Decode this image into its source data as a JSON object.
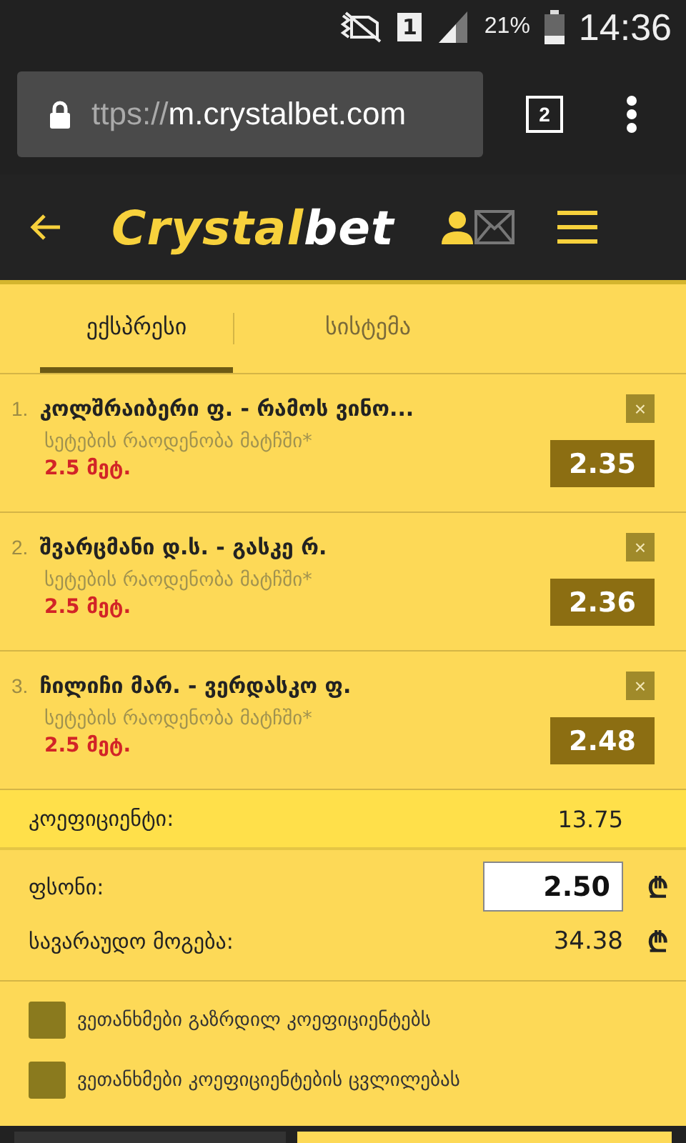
{
  "status_bar": {
    "battery_text": "21%",
    "time": "14:36",
    "sim": "1"
  },
  "browser": {
    "url_scheme": "ttps://",
    "url_host": "m.crystalbet.com",
    "tab_count": "2"
  },
  "header": {
    "logo_first": "Crystal",
    "logo_second": "bet"
  },
  "tabs": [
    {
      "label": "ექსპრესი",
      "selected": true
    },
    {
      "label": "სისტემა",
      "selected": false
    }
  ],
  "bets": [
    {
      "number": "1.",
      "match": "კოლშრაიბერი ფ. - რამოს ვინო...",
      "market": "სეტების რაოდენობა მატჩში*",
      "pick": "2.5 მეტ.",
      "odds": "2.35",
      "remove": "×"
    },
    {
      "number": "2.",
      "match": "შვარცმანი დ.ს. - გასკე რ.",
      "market": "სეტების რაოდენობა მატჩში*",
      "pick": "2.5 მეტ.",
      "odds": "2.36",
      "remove": "×"
    },
    {
      "number": "3.",
      "match": "ჩილიჩი მარ. - ვერდასკო ფ.",
      "market": "სეტების რაოდენობა მატჩში*",
      "pick": "2.5 მეტ.",
      "odds": "2.48",
      "remove": "×"
    }
  ],
  "total": {
    "label": "კოეფიციენტი:",
    "value": "13.75"
  },
  "stake": {
    "label": "ფსონი:",
    "value": "2.50",
    "currency": "₾"
  },
  "winnings": {
    "label": "სავარაუდო მოგება:",
    "value": "34.38",
    "currency": "₾"
  },
  "options": [
    {
      "label": "ვეთანხმები გაზრდილ კოეფიციენტებს",
      "checked": false
    },
    {
      "label": "ვეთანხმები კოეფიციენტების ცვლილებას",
      "checked": false
    }
  ]
}
